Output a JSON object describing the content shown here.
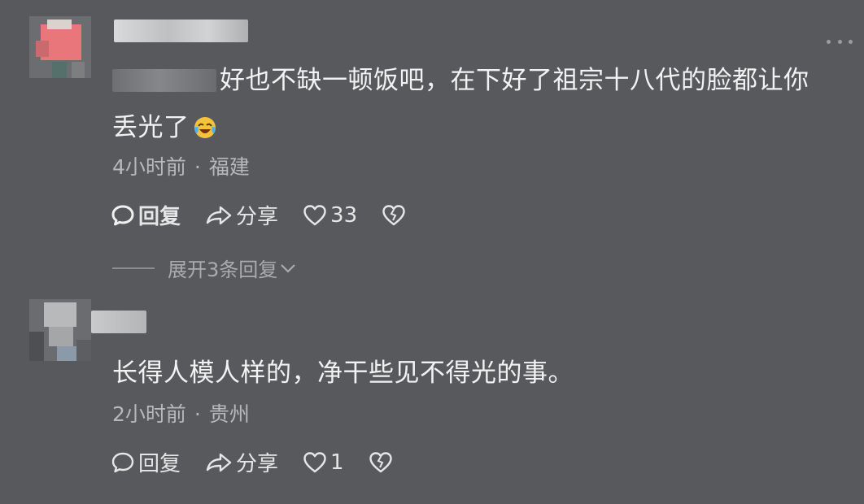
{
  "comments": [
    {
      "text_parts": [
        "好也不缺一顿饭吧，在下好了祖宗十八代的脸都让你",
        "丢光了"
      ],
      "emoji_icon": "laughing-crying-face-icon",
      "time": "4小时前",
      "dot": "·",
      "location": "福建",
      "reply_label": "回复",
      "share_label": "分享",
      "like_count": "33",
      "expand_label": "展开3条回复"
    },
    {
      "text": "长得人模人样的，净干些见不得光的事。",
      "time": "2小时前",
      "dot": "·",
      "location": "贵州",
      "reply_label": "回复",
      "share_label": "分享",
      "like_count": "1"
    }
  ],
  "colors": {
    "background": "#57595c",
    "text": "#f2f2f2",
    "meta": "#b6b8ba"
  }
}
